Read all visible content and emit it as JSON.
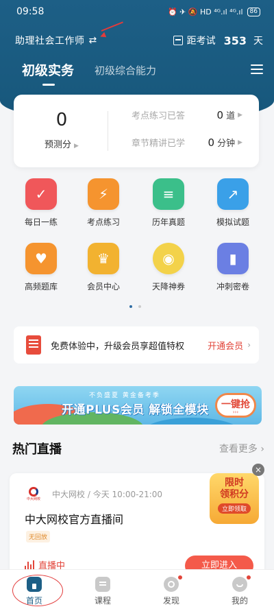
{
  "status_bar": {
    "time": "09:58",
    "icons": "⏰ ✈ 🔕 HD ⁴ᴳ.ıl ⁴ᴳ.ıl",
    "battery": "86"
  },
  "header": {
    "exam_name": "助理社会工作师",
    "swap_icon": "⇄",
    "countdown_label": "距考试",
    "countdown_value": "353",
    "countdown_unit": "天"
  },
  "tabs": {
    "active": "初级实务",
    "other": "初级综合能力"
  },
  "score_card": {
    "score": "0",
    "score_label": "预测分",
    "practice_label": "考点练习已答",
    "practice_value": "0",
    "practice_unit": "道",
    "study_label": "章节精讲已学",
    "study_value": "0",
    "study_unit": "分钟"
  },
  "features": [
    {
      "label": "每日一练",
      "icon": "calendar-check-icon",
      "color": "#f0575a"
    },
    {
      "label": "考点练习",
      "icon": "lightning-doc-icon",
      "color": "#f5942f"
    },
    {
      "label": "历年真题",
      "icon": "document-icon",
      "color": "#3bbf8a"
    },
    {
      "label": "模拟试题",
      "icon": "chart-screen-icon",
      "color": "#3aa0e8"
    },
    {
      "label": "高频题库",
      "icon": "heart-book-icon",
      "color": "#f5942f"
    },
    {
      "label": "会员中心",
      "icon": "crown-icon",
      "color": "#f2b230"
    },
    {
      "label": "天降神券",
      "icon": "lucky-egg-icon",
      "color": "#f3d24a"
    },
    {
      "label": "冲刺密卷",
      "icon": "bookmark-book-icon",
      "color": "#6b7fe3"
    }
  ],
  "promo": {
    "text": "免费体验中，升级会员享超值特权",
    "cta": "开通会员"
  },
  "banner": {
    "small": "不负盛夏 黄金备考季",
    "main": "开通PLUS会员 解锁全模块",
    "button": "一键抢"
  },
  "live_section": {
    "title": "热门直播",
    "more": "查看更多",
    "card": {
      "school": "中大网校",
      "day": "今天",
      "time": "10:00-21:00",
      "title": "中大网校官方直播间",
      "tag": "无回放",
      "status": "直播中",
      "button": "立即进入"
    }
  },
  "floating_badge": {
    "line1": "限时",
    "line2": "领积分",
    "button": "立即领取",
    "close": "×"
  },
  "bottom_nav": [
    {
      "label": "首页",
      "icon": "home-icon"
    },
    {
      "label": "课程",
      "icon": "course-icon"
    },
    {
      "label": "发现",
      "icon": "discover-icon"
    },
    {
      "label": "我的",
      "icon": "profile-icon"
    }
  ]
}
